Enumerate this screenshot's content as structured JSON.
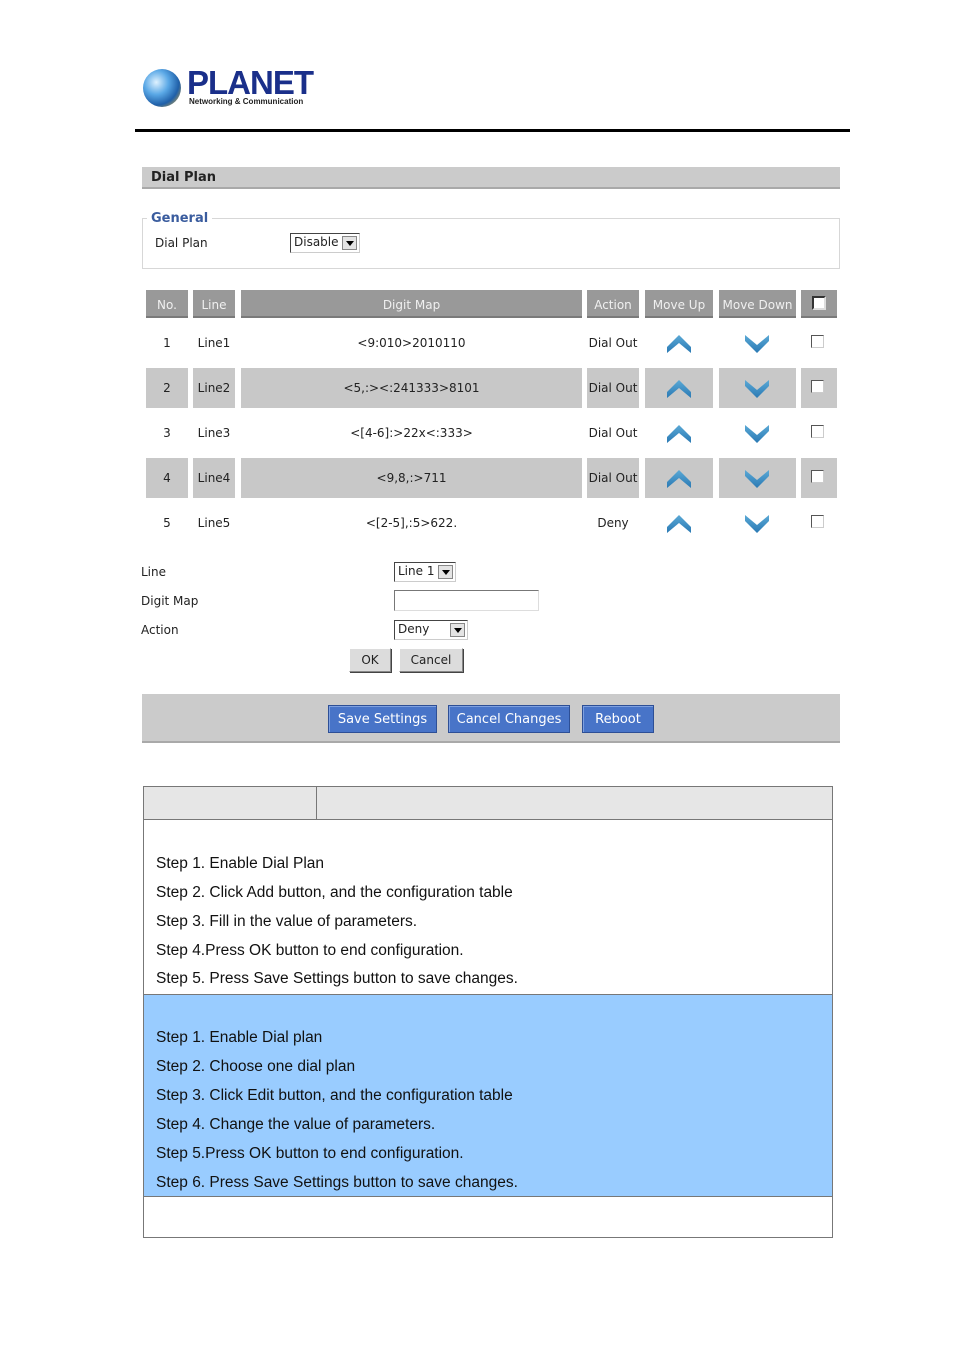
{
  "logo": {
    "brand": "PLANET",
    "tagline": "Networking & Communication"
  },
  "panel": {
    "title": "Dial Plan",
    "general_legend": "General",
    "dial_plan_label": "Dial Plan",
    "dial_plan_value": "Disable"
  },
  "table": {
    "headers": {
      "no": "No.",
      "line": "Line",
      "digit_map": "Digit Map",
      "action": "Action",
      "move_up": "Move Up",
      "move_down": "Move Down"
    },
    "rows": [
      {
        "no": "1",
        "line": "Line1",
        "digit_map": "<9:010>2010110",
        "action": "Dial Out"
      },
      {
        "no": "2",
        "line": "Line2",
        "digit_map": "<5,:><:241333>8101",
        "action": "Dial Out"
      },
      {
        "no": "3",
        "line": "Line3",
        "digit_map": "<[4-6]:>22x<:333>",
        "action": "Dial Out"
      },
      {
        "no": "4",
        "line": "Line4",
        "digit_map": "<9,8,:>711",
        "action": "Dial Out"
      },
      {
        "no": "5",
        "line": "Line5",
        "digit_map": "<[2-5],:5>622.",
        "action": "Deny"
      }
    ],
    "icons": {
      "up": "chevron-up-icon",
      "down": "chevron-down-icon"
    }
  },
  "form": {
    "line_label": "Line",
    "line_value": "Line 1",
    "digit_map_label": "Digit Map",
    "digit_map_value": "",
    "action_label": "Action",
    "action_value": "Deny",
    "ok_label": "OK",
    "cancel_label": "Cancel"
  },
  "bottom_bar": {
    "save_label": "Save Settings",
    "cancel_changes_label": "Cancel Changes",
    "reboot_label": "Reboot"
  },
  "doc": {
    "header_col1": "",
    "header_col2": "",
    "add_steps": [
      "Step 1. Enable Dial Plan",
      "Step 2. Click Add button, and the configuration table",
      "Step 3. Fill in the value of parameters.",
      "Step 4.Press OK button to end configuration.",
      "Step 5. Press Save Settings button to save changes."
    ],
    "edit_steps": [
      "Step 1. Enable Dial plan",
      "Step 2. Choose one dial plan",
      "Step 3. Click Edit button, and the configuration table",
      "Step 4. Change the value of parameters.",
      "Step 5.Press OK button to end configuration.",
      "Step 6. Press Save Settings button to save changes."
    ]
  },
  "colors": {
    "header_gray": "#999999",
    "row_shaded": "#c8c8c8",
    "button_blue": "#4874c8",
    "highlight_blue": "#99ccff",
    "legend_blue": "#3a5c9e",
    "icon_blue": "#3a8fc4"
  }
}
